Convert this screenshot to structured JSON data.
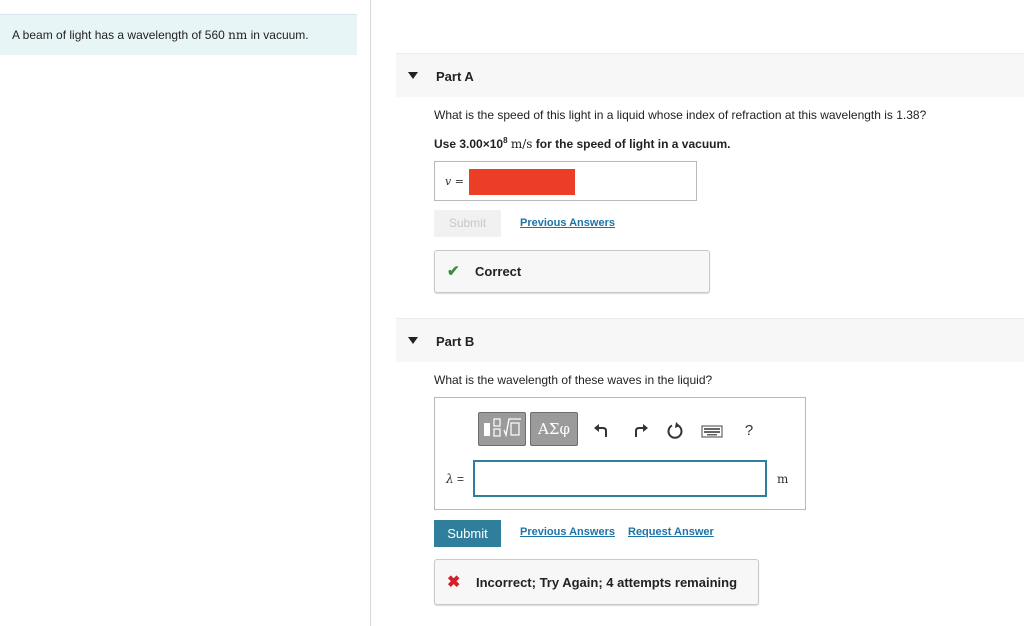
{
  "problem": {
    "prefix": "A beam of light has a wavelength of 560 ",
    "unit": "nm",
    "suffix": " in vacuum."
  },
  "part_a": {
    "title": "Part A",
    "question": "What is the speed of this light in a liquid whose index of refraction at this wavelength is 1.38?",
    "hint_prefix": "Use 3.00×10",
    "hint_exponent": "8",
    "hint_unit": "m/s",
    "hint_suffix": "for the speed of light in a vacuum.",
    "variable_label": "v =",
    "submit_label": "Submit",
    "previous_answers_label": "Previous Answers",
    "feedback_text": "Correct"
  },
  "part_b": {
    "title": "Part B",
    "question": "What is the wavelength of these waves in the liquid?",
    "toolbar": {
      "templates_icon": "templates-icon",
      "symbols_label": "ΑΣφ",
      "undo_icon": "undo-icon",
      "redo_icon": "redo-icon",
      "reset_icon": "reset-icon",
      "keyboard_icon": "keyboard-icon",
      "help_label": "?"
    },
    "variable_symbol": "λ",
    "variable_eq": " =",
    "answer_value": "",
    "unit": "m",
    "submit_label": "Submit",
    "previous_answers_label": "Previous Answers",
    "request_answer_label": "Request Answer",
    "feedback_text": "Incorrect; Try Again; 4 attempts remaining"
  },
  "colors": {
    "accent": "#2f7e9c",
    "link": "#1c73a8",
    "correct": "#3c8d3c",
    "incorrect": "#d0222b",
    "problem_bg": "#e8f5f7",
    "redacted": "#ec3e26"
  }
}
